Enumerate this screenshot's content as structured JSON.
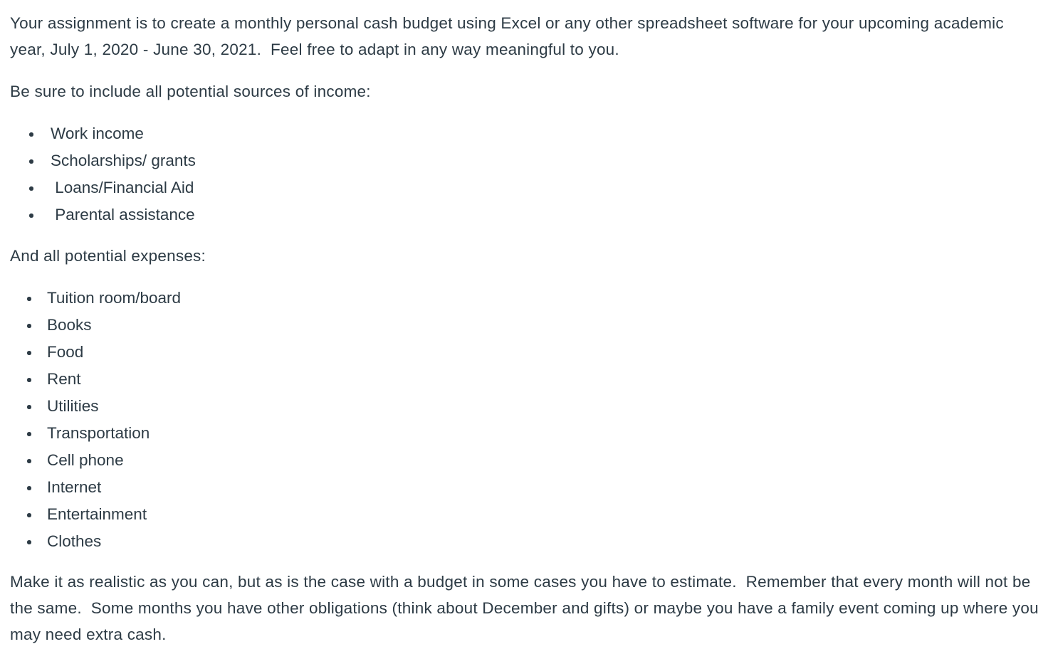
{
  "document": {
    "intro_paragraph": "Your assignment is to create a monthly personal cash budget using Excel or any other spreadsheet software for your upcoming academic year, July 1, 2020 - June 30, 2021.  Feel free to adapt in any way meaningful to you.",
    "income_heading": "Be sure to include all potential sources of income:",
    "income_items": [
      "Work income",
      "Scholarships/ grants",
      " Loans/Financial Aid",
      " Parental assistance"
    ],
    "expenses_heading": "And all potential expenses:",
    "expense_items": [
      "Tuition room/board",
      "Books",
      "Food",
      "Rent",
      "Utilities",
      "Transportation",
      "Cell phone",
      "Internet",
      "Entertainment",
      "Clothes"
    ],
    "closing_paragraph": "Make it as realistic as you can, but as is the case with a budget in some cases you have to estimate.  Remember that every month will not be the same.  Some months you have other obligations (think about December and gifts) or maybe you have a family event coming up where you may need extra cash."
  },
  "colors": {
    "text": "#2D3B45",
    "background": "#FFFFFF"
  }
}
